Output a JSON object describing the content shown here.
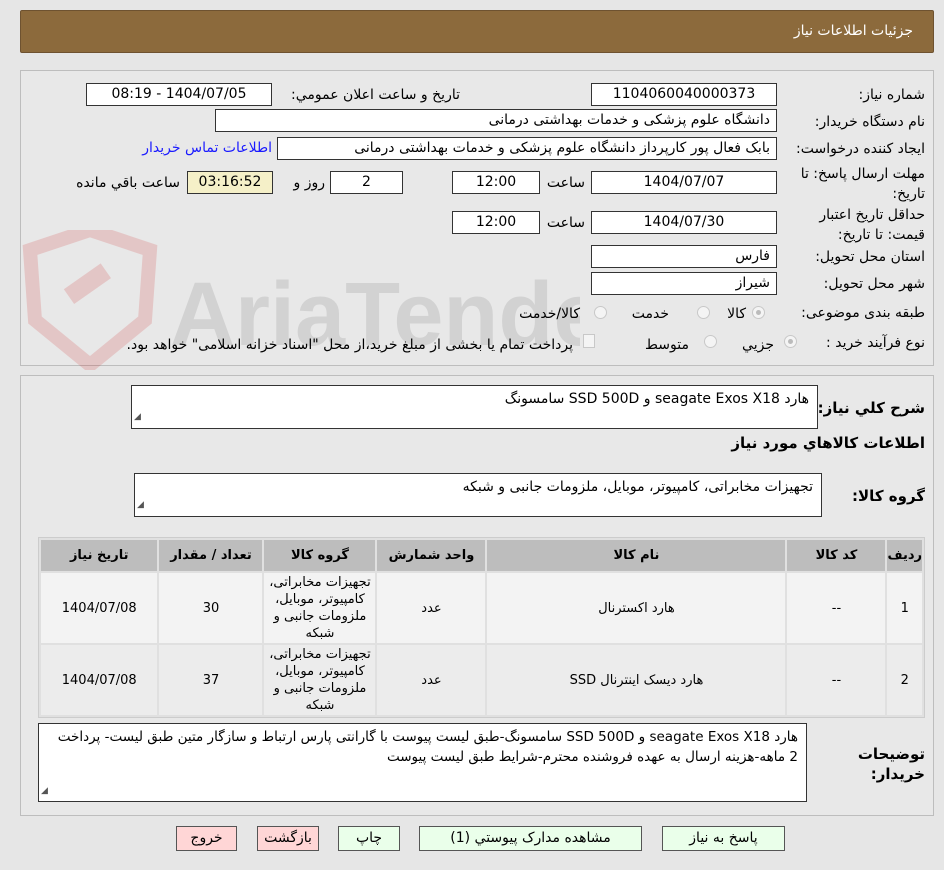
{
  "header": {
    "title": "جزئيات اطلاعات نياز"
  },
  "form": {
    "need_number_label": "شماره نياز:",
    "need_number": "1104060040000373",
    "announce_label": "تاريخ و ساعت اعلان عمومي:",
    "announce_value": "1404/07/05 - 08:19",
    "buyer_org_label": "نام دستگاه خريدار:",
    "buyer_org": "دانشگاه علوم پزشکی و خدمات بهداشتی درمانی",
    "creator_label": "ايجاد کننده درخواست:",
    "creator": "بابک فعال پور کارپرداز دانشگاه علوم پزشکی و خدمات بهداشتی درمانی",
    "contact_link": "اطلاعات تماس خريدار",
    "deadline_label": "مهلت ارسال پاسخ: تا تاريخ:",
    "deadline_date": "1404/07/07",
    "time_label": "ساعت",
    "deadline_time": "12:00",
    "days": "2",
    "days_label": "روز و",
    "remaining": "03:16:52",
    "remaining_label": "ساعت باقي مانده",
    "validity_label": "حداقل تاريخ اعتبار قيمت: تا تاريخ:",
    "validity_date": "1404/07/30",
    "validity_time": "12:00",
    "province_label": "استان محل تحويل:",
    "province": "فارس",
    "city_label": "شهر محل تحويل:",
    "city": "شيراز",
    "category_label": "طبقه بندی موضوعی:",
    "category_options": [
      "کالا",
      "خدمت",
      "کالا/خدمت"
    ],
    "category_selected": "کالا",
    "process_label": "نوع فرآيند خريد :",
    "process_options": [
      "جزيي",
      "متوسط"
    ],
    "payment_note": "پرداخت تمام يا بخشی از مبلغ خريد،از محل \"اسناد خزانه اسلامی\" خواهد بود."
  },
  "details": {
    "summary_label": "شرح کلي نياز:",
    "summary": "هارد seagate Exos X18 و SSD 500D سامسونگ",
    "goods_heading": "اطلاعات کالاهاي مورد نياز",
    "group_label": "گروه کالا:",
    "group": "تجهيزات مخابراتی، کامپيوتر، موبايل، ملزومات جانبی و شبکه",
    "table": {
      "headers": [
        "رديف",
        "کد کالا",
        "نام کالا",
        "واحد شمارش",
        "گروه کالا",
        "تعداد / مقدار",
        "تاريخ نياز"
      ],
      "rows": [
        [
          "1",
          "--",
          "هارد اکسترنال",
          "عدد",
          "تجهيزات مخابراتی، کامپيوتر، موبايل، ملزومات جانبی و شبکه",
          "30",
          "1404/07/08"
        ],
        [
          "2",
          "--",
          "هارد ديسک اينترنال SSD",
          "عدد",
          "تجهيزات مخابراتی، کامپيوتر، موبايل، ملزومات جانبی و شبکه",
          "37",
          "1404/07/08"
        ]
      ]
    },
    "notes_label": "توضيحات خريدار:",
    "notes": "هارد seagate Exos X18 و SSD 500D سامسونگ-طبق ليست پيوست با گارانتی پارس ارتباط و سازگار متين طبق ليست- پرداخت 2 ماهه-هزينه ارسال به عهده فروشنده محترم-شرايط طبق ليست پيوست"
  },
  "buttons": {
    "reply": "پاسخ به نياز",
    "attachments": "مشاهده مدارک پيوستي (1)",
    "print": "چاپ",
    "back": "بازگشت",
    "exit": "خروج"
  },
  "watermark": "AriaTender.net"
}
